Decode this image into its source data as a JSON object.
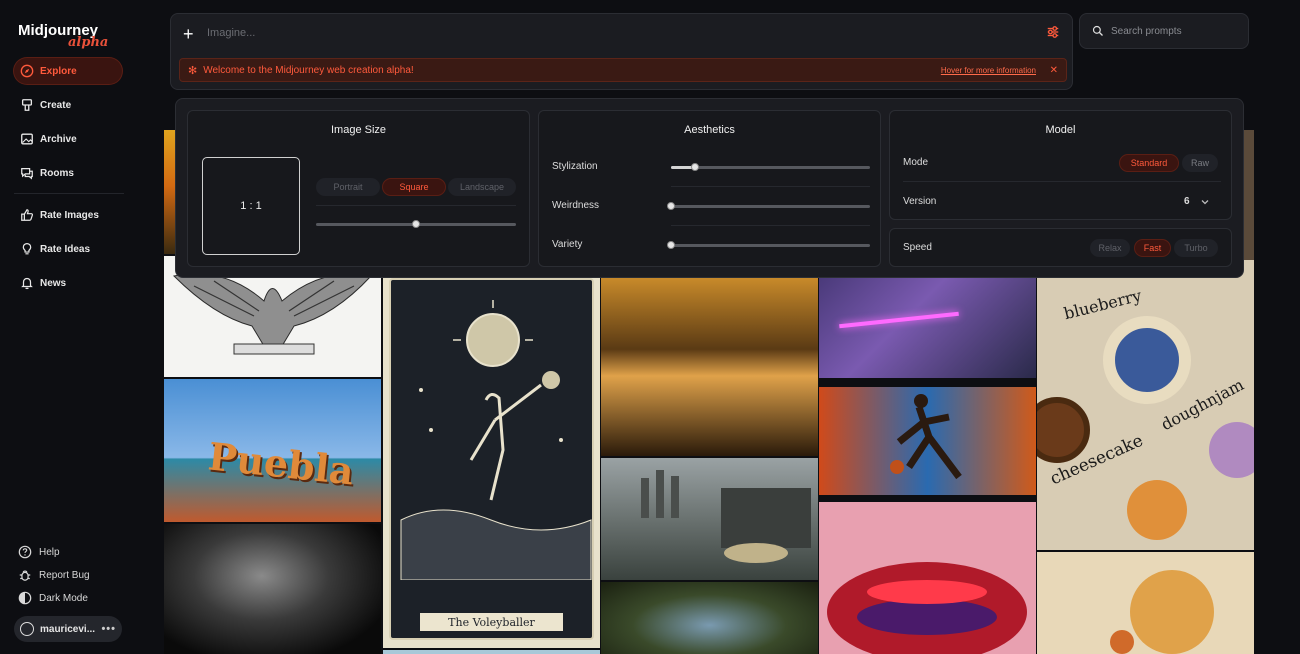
{
  "brand": {
    "name": "Midjourney",
    "tag": "alpha"
  },
  "nav": {
    "explore": "Explore",
    "create": "Create",
    "archive": "Archive",
    "rooms": "Rooms",
    "rate_images": "Rate Images",
    "rate_ideas": "Rate Ideas",
    "news": "News"
  },
  "footer": {
    "help": "Help",
    "report_bug": "Report Bug",
    "dark_mode": "Dark Mode",
    "username": "mauricevi...",
    "more": "•••"
  },
  "prompt": {
    "placeholder": "Imagine...",
    "alert": "Welcome to the Midjourney web creation alpha!",
    "alert_link": "Hover for more information"
  },
  "search": {
    "placeholder": "Search prompts"
  },
  "image_size": {
    "title": "Image Size",
    "ratio": "1 : 1",
    "options": [
      "Portrait",
      "Square",
      "Landscape"
    ],
    "selected": "Square",
    "slider_value": 0.5
  },
  "aesthetics": {
    "title": "Aesthetics",
    "stylization": {
      "label": "Stylization",
      "value": 0.12
    },
    "weirdness": {
      "label": "Weirdness",
      "value": 0.0
    },
    "variety": {
      "label": "Variety",
      "value": 0.0
    }
  },
  "model": {
    "title": "Model",
    "mode_label": "Mode",
    "modes": [
      "Standard",
      "Raw"
    ],
    "mode_selected": "Standard",
    "version_label": "Version",
    "version": "6",
    "speed_label": "Speed",
    "speeds": [
      "Relax",
      "Fast",
      "Turbo"
    ],
    "speed_selected": "Fast"
  },
  "gallery_captions": {
    "tarot": "The Voleyballer",
    "sign": "Puebla",
    "embroidery_1": "blueberry",
    "embroidery_2": "doughnjam",
    "embroidery_3": "cheesecake"
  },
  "colors": {
    "accent": "#ff5a3c",
    "bg": "#0d0e12",
    "panel": "#1b1c21"
  }
}
